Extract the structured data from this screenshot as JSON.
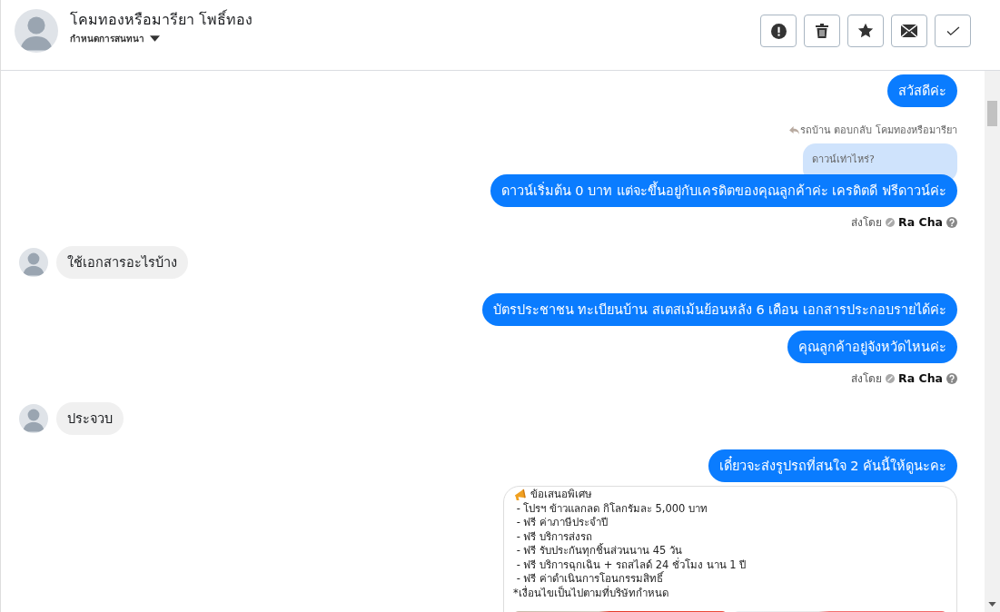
{
  "header": {
    "name": "โคมทองหรือมารียา โพธิ์ทอง",
    "subtitle": "กำหนดการสนทนา",
    "actions": [
      {
        "kind": "alert"
      },
      {
        "kind": "trash"
      },
      {
        "kind": "star"
      },
      {
        "kind": "mail"
      },
      {
        "kind": "check"
      }
    ]
  },
  "messages": [
    {
      "kind": "out",
      "text": "สวัสดีค่ะ"
    },
    {
      "kind": "reply",
      "note": "รถบ้าน ตอบกลับ โคมทองหรือมารียา",
      "quoted": "ดาวน์เท่าไหร่?"
    },
    {
      "kind": "out",
      "text": "ดาวน์เริ่มต้น 0 บาท แต่จะขึ้นอยู่กับเครดิตของคุณลูกค้าค่ะ เครดิตดี ฟรีดาวน์ค่ะ"
    },
    {
      "kind": "sent_by",
      "label": "ส่งโดย",
      "name": "Ra Cha"
    },
    {
      "kind": "in",
      "text": "ใช้เอกสารอะไรบ้าง"
    },
    {
      "kind": "out",
      "text": "บัตรประชาชน ทะเบียนบ้าน สเตสเม้นย้อนหลัง 6 เดือน เอกสารประกอบรายได้ค่ะ"
    },
    {
      "kind": "out",
      "text": "คุณลูกค้าอยู่จังหวัดไหนค่ะ"
    },
    {
      "kind": "sent_by",
      "label": "ส่งโดย",
      "name": "Ra Cha"
    },
    {
      "kind": "in",
      "text": "ประจวบ"
    },
    {
      "kind": "out",
      "text": "เดี๋ยวจะส่งรูปรถที่สนใจ 2 คันนี้ให้ดูนะคะ"
    },
    {
      "kind": "card",
      "title": "ข้อเสนอพิเศษ",
      "lines": [
        " - โปรฯ ข้าวแลกลด กิโลกรัมละ 5,000 บาท",
        " - ฟรี ค่าภาษีประจำปี",
        " - ฟรี บริการส่งรถ",
        " - ฟรี รับประกันทุกชิ้นส่วนนาน 45 วัน",
        " - ฟรี บริการฉุกเฉิน + รถสไลด์ 24 ชั่วโมง นาน 1 ปี",
        " - ฟรี ค่าดำเนินการโอนกรรมสิทธิ์",
        "*เงื่อนไขเป็นไปตามที่บริษัทกำหนด"
      ],
      "photos": [
        {
          "kind": "photo"
        },
        {
          "kind": "photo"
        }
      ]
    }
  ]
}
